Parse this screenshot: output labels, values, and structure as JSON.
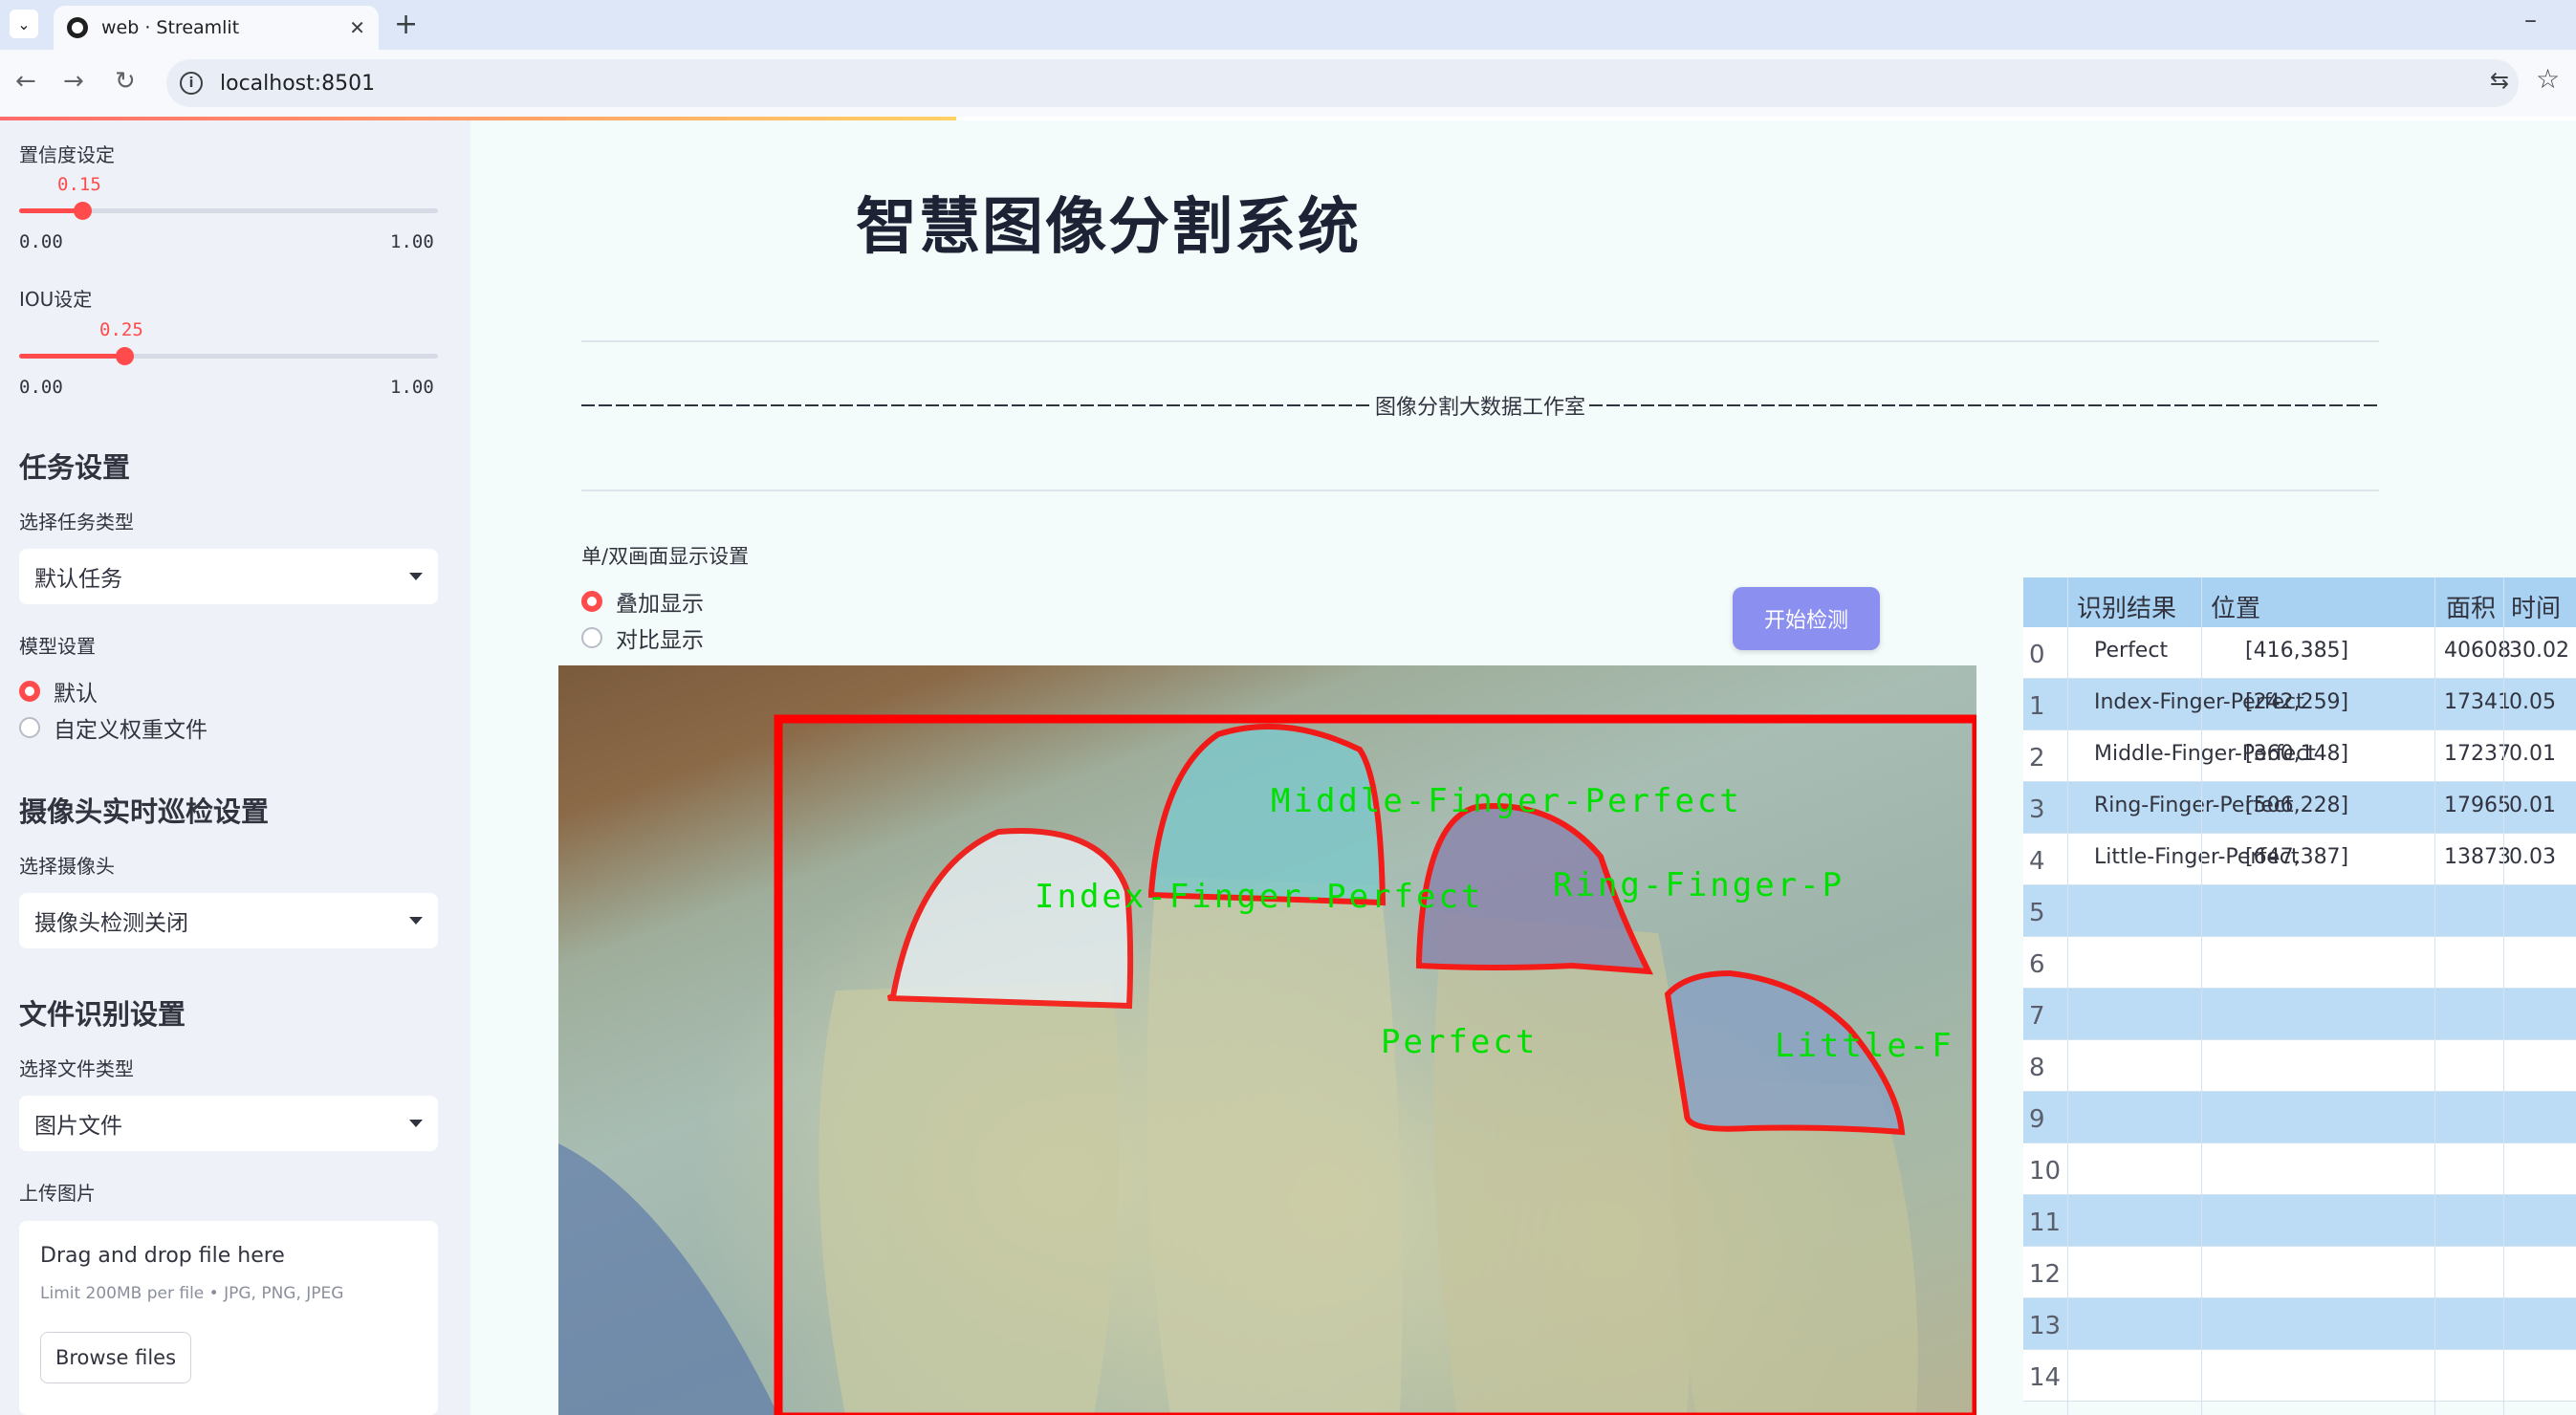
{
  "browser": {
    "tab_title": "web · Streamlit",
    "tab_close": "✕",
    "new_tab": "+",
    "url": "localhost:8501"
  },
  "sidebar": {
    "confidence": {
      "label": "置信度设定",
      "value": "0.15",
      "min": "0.00",
      "max": "1.00",
      "fraction": 0.15
    },
    "iou": {
      "label": "IOU设定",
      "value": "0.25",
      "min": "0.00",
      "max": "1.00",
      "fraction": 0.25
    },
    "task_heading": "任务设置",
    "task_type_label": "选择任务类型",
    "task_type_value": "默认任务",
    "model_label": "模型设置",
    "model_options": [
      "默认",
      "自定义权重文件"
    ],
    "model_selected": 0,
    "camera_heading": "摄像头实时巡检设置",
    "camera_label": "选择摄像头",
    "camera_value": "摄像头检测关闭",
    "file_heading": "文件识别设置",
    "file_type_label": "选择文件类型",
    "file_type_value": "图片文件",
    "upload_label": "上传图片",
    "upload_title": "Drag and drop file here",
    "upload_limit": "Limit 200MB per file • JPG, PNG, JPEG",
    "browse_label": "Browse files"
  },
  "main": {
    "title": "智慧图像分割系统",
    "studio_text": "图像分割大数据工作室",
    "display_mode_label": "单/双画面显示设置",
    "display_options": [
      "叠加显示",
      "对比显示"
    ],
    "display_selected": 0,
    "detect_button": "开始检测"
  },
  "detections_overlay": [
    {
      "label": "Middle-Finger-Perfect"
    },
    {
      "label": "Index-Finger-Perfect"
    },
    {
      "label": "Ring-Finger-P"
    },
    {
      "label": "Perfect"
    },
    {
      "label": "Little-F"
    }
  ],
  "colors": {
    "accent": "#ff4b4b",
    "mask_stroke": "#ff0000",
    "label_green": "#00e000",
    "button": "#8b8ff0",
    "table_header": "#a9d1f2"
  },
  "table": {
    "columns": [
      "识别结果",
      "位置",
      "面积",
      "时间"
    ],
    "rows": [
      {
        "idx": "0",
        "result": "Perfect",
        "pos": "[416,385]",
        "area": "40608",
        "time": "30.02"
      },
      {
        "idx": "1",
        "result": "Index-Finger-Perfect",
        "pos": "[242,259]",
        "area": "17341",
        "time": "0.05"
      },
      {
        "idx": "2",
        "result": "Middle-Finger-Perfect",
        "pos": "[360,148]",
        "area": "17237",
        "time": "0.01"
      },
      {
        "idx": "3",
        "result": "Ring-Finger-Perfect",
        "pos": "[506,228]",
        "area": "17965",
        "time": "0.01"
      },
      {
        "idx": "4",
        "result": "Little-Finger-Perfect",
        "pos": "[647,387]",
        "area": "13873",
        "time": "0.03"
      },
      {
        "idx": "5",
        "result": "",
        "pos": "",
        "area": "",
        "time": ""
      },
      {
        "idx": "6",
        "result": "",
        "pos": "",
        "area": "",
        "time": ""
      },
      {
        "idx": "7",
        "result": "",
        "pos": "",
        "area": "",
        "time": ""
      },
      {
        "idx": "8",
        "result": "",
        "pos": "",
        "area": "",
        "time": ""
      },
      {
        "idx": "9",
        "result": "",
        "pos": "",
        "area": "",
        "time": ""
      },
      {
        "idx": "10",
        "result": "",
        "pos": "",
        "area": "",
        "time": ""
      },
      {
        "idx": "11",
        "result": "",
        "pos": "",
        "area": "",
        "time": ""
      },
      {
        "idx": "12",
        "result": "",
        "pos": "",
        "area": "",
        "time": ""
      },
      {
        "idx": "13",
        "result": "",
        "pos": "",
        "area": "",
        "time": ""
      },
      {
        "idx": "14",
        "result": "",
        "pos": "",
        "area": "",
        "time": ""
      }
    ]
  }
}
